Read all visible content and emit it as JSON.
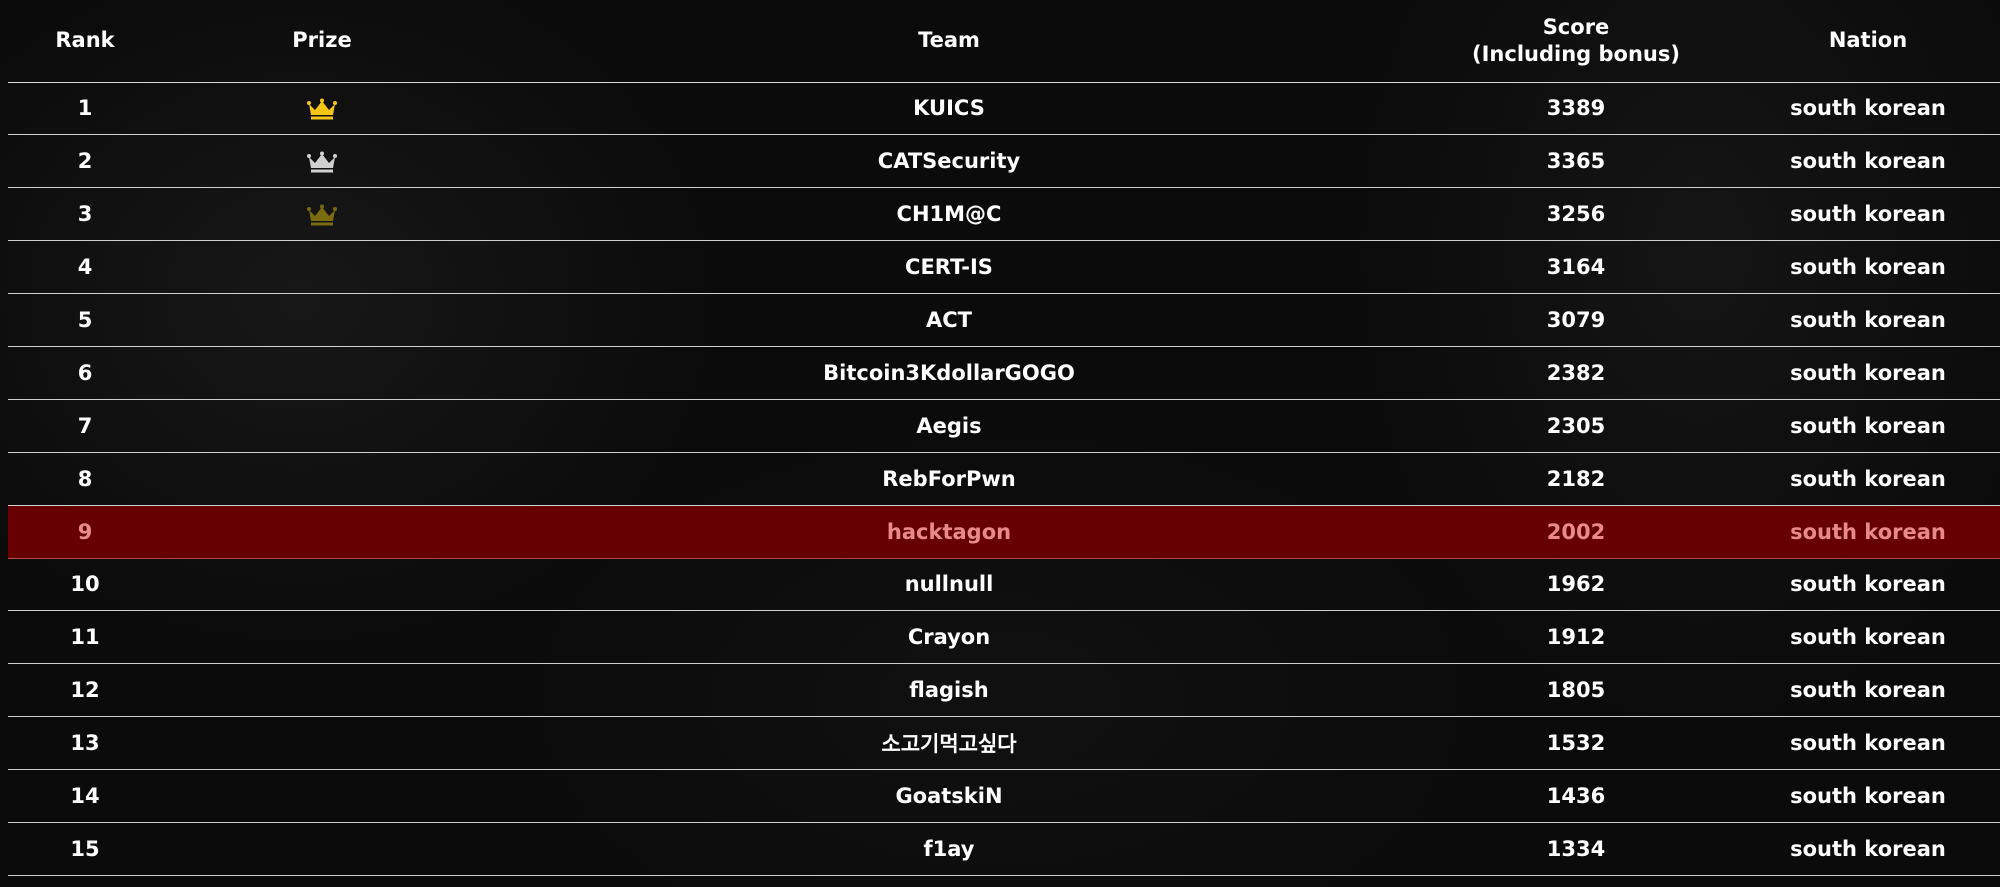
{
  "headers": {
    "rank": "Rank",
    "prize": "Prize",
    "team": "Team",
    "score_line1": "Score",
    "score_line2": "(Including bonus)",
    "nation": "Nation"
  },
  "colors": {
    "gold": "#f5c518",
    "silver": "#d0d0d0",
    "bronze": "#7a6a10",
    "highlight_bg": "#660000",
    "highlight_text": "#e88a8a"
  },
  "rows": [
    {
      "rank": "1",
      "prize": "crown-gold-icon",
      "team": "KUICS",
      "score": "3389",
      "nation": "south korean"
    },
    {
      "rank": "2",
      "prize": "crown-silver-icon",
      "team": "CATSecurity",
      "score": "3365",
      "nation": "south korean"
    },
    {
      "rank": "3",
      "prize": "crown-bronze-icon",
      "team": "CH1M@C",
      "score": "3256",
      "nation": "south korean"
    },
    {
      "rank": "4",
      "prize": "",
      "team": "CERT-IS",
      "score": "3164",
      "nation": "south korean"
    },
    {
      "rank": "5",
      "prize": "",
      "team": "ACT",
      "score": "3079",
      "nation": "south korean"
    },
    {
      "rank": "6",
      "prize": "",
      "team": "Bitcoin3KdollarGOGO",
      "score": "2382",
      "nation": "south korean"
    },
    {
      "rank": "7",
      "prize": "",
      "team": "Aegis",
      "score": "2305",
      "nation": "south korean"
    },
    {
      "rank": "8",
      "prize": "",
      "team": "RebForPwn",
      "score": "2182",
      "nation": "south korean"
    },
    {
      "rank": "9",
      "prize": "",
      "team": "hacktagon",
      "score": "2002",
      "nation": "south korean",
      "highlighted": true
    },
    {
      "rank": "10",
      "prize": "",
      "team": "nullnull",
      "score": "1962",
      "nation": "south korean"
    },
    {
      "rank": "11",
      "prize": "",
      "team": "Crayon",
      "score": "1912",
      "nation": "south korean"
    },
    {
      "rank": "12",
      "prize": "",
      "team": "flagish",
      "score": "1805",
      "nation": "south korean"
    },
    {
      "rank": "13",
      "prize": "",
      "team": "소고기먹고싶다",
      "score": "1532",
      "nation": "south korean"
    },
    {
      "rank": "14",
      "prize": "",
      "team": "GoatskiN",
      "score": "1436",
      "nation": "south korean"
    },
    {
      "rank": "15",
      "prize": "",
      "team": "f1ay",
      "score": "1334",
      "nation": "south korean"
    }
  ]
}
